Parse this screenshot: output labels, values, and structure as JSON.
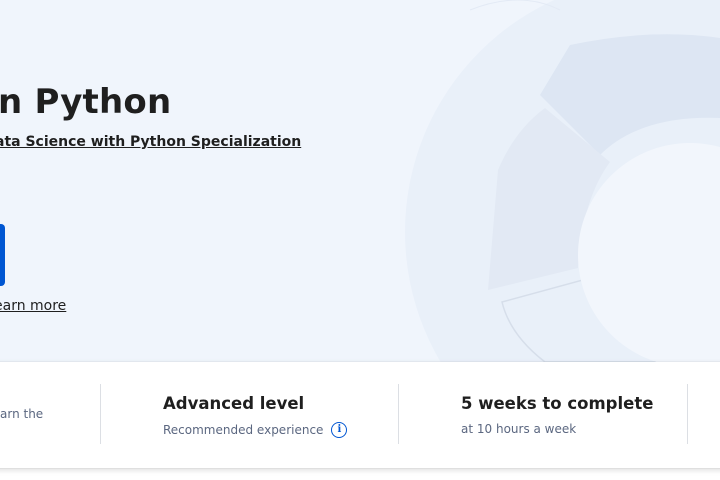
{
  "hero": {
    "title": "n Python",
    "specialization_link": "ata Science with Python Specialization",
    "learn_more": "earn more"
  },
  "info_card": {
    "partial_text": "arn the",
    "level": {
      "title": "Advanced level",
      "subtitle": "Recommended experience",
      "icon": "info-circle-icon"
    },
    "duration": {
      "title": "5 weeks to complete",
      "subtitle": "at 10 hours a week"
    }
  },
  "colors": {
    "hero_background": "#f0f5fc",
    "primary_blue": "#0056d2",
    "text_primary": "#1f1f1f",
    "text_secondary": "#5b6780"
  }
}
